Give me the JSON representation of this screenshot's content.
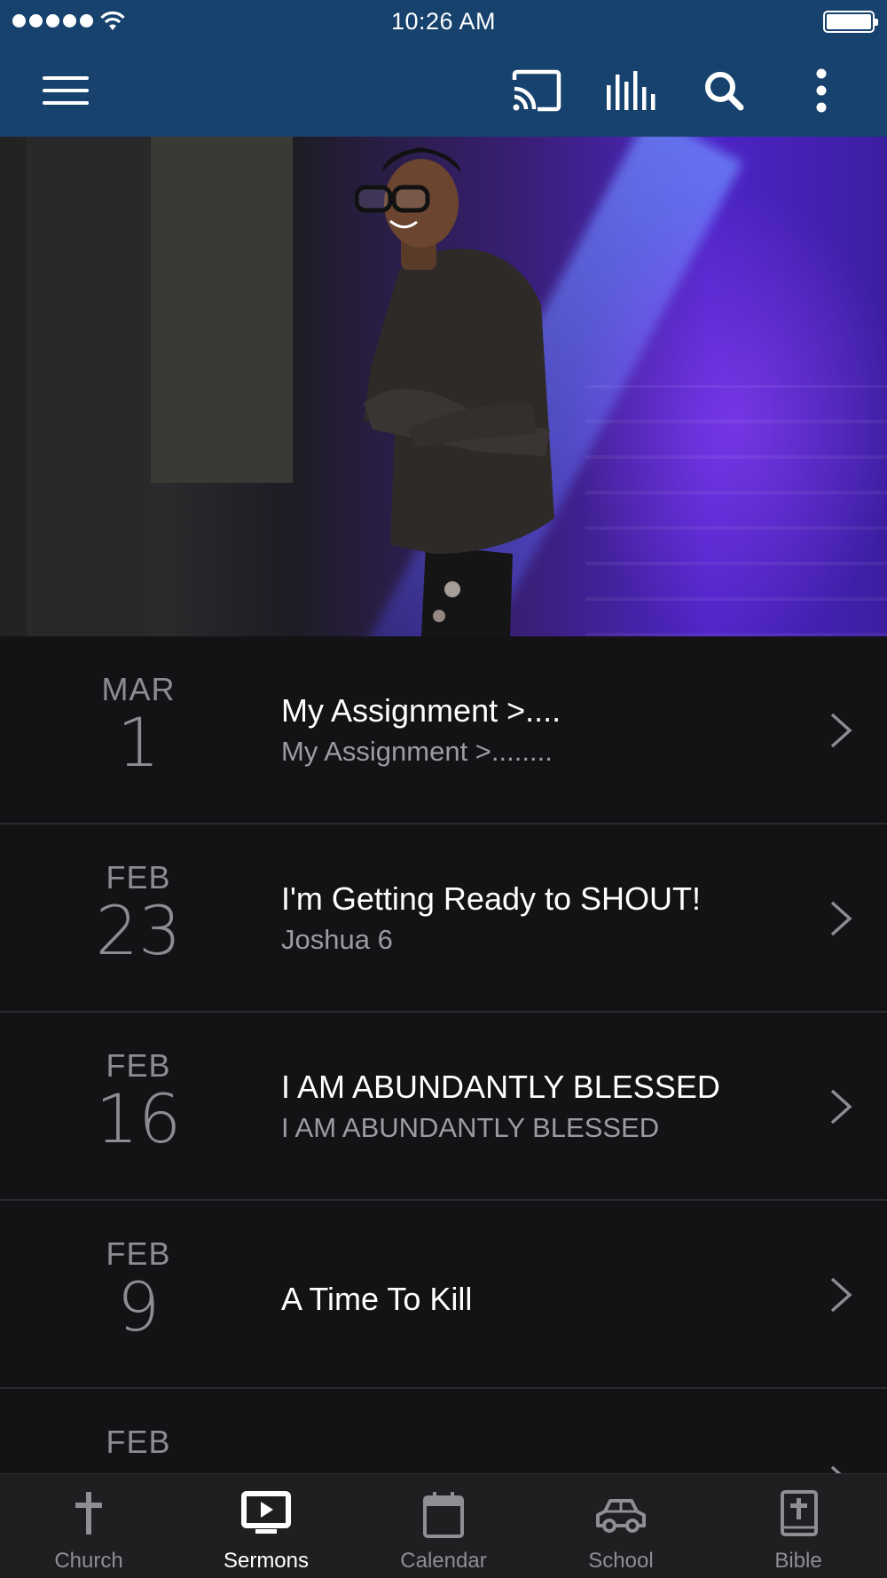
{
  "status_bar": {
    "time": "10:26 AM"
  },
  "header": {
    "icons": [
      "menu-icon",
      "cast-icon",
      "audio-levels-icon",
      "search-icon",
      "more-vertical-icon"
    ]
  },
  "hero": {
    "icon": "speaker-photo"
  },
  "sermons": [
    {
      "month": "MAR",
      "day": "1",
      "title": "My Assignment >....",
      "subtitle": "My Assignment   >........"
    },
    {
      "month": "FEB",
      "day": "23",
      "title": "I'm Getting Ready to SHOUT!",
      "subtitle": "Joshua 6"
    },
    {
      "month": "FEB",
      "day": "16",
      "title": "I AM ABUNDANTLY BLESSED",
      "subtitle": "I AM ABUNDANTLY BLESSED"
    },
    {
      "month": "FEB",
      "day": "9",
      "title": "A Time To Kill",
      "subtitle": ""
    },
    {
      "month": "FEB",
      "day": "",
      "title": "",
      "subtitle": ""
    }
  ],
  "tabs": [
    {
      "label": "Church",
      "icon": "cross-icon",
      "active": false
    },
    {
      "label": "Sermons",
      "icon": "play-tv-icon",
      "active": true
    },
    {
      "label": "Calendar",
      "icon": "calendar-icon",
      "active": false
    },
    {
      "label": "School",
      "icon": "car-icon",
      "active": false
    },
    {
      "label": "Bible",
      "icon": "bible-icon",
      "active": false
    }
  ],
  "colors": {
    "header_bg": "#17426e",
    "list_bg": "#131316",
    "tabbar_bg": "#1f1f22",
    "muted_text": "#8c8c92"
  }
}
